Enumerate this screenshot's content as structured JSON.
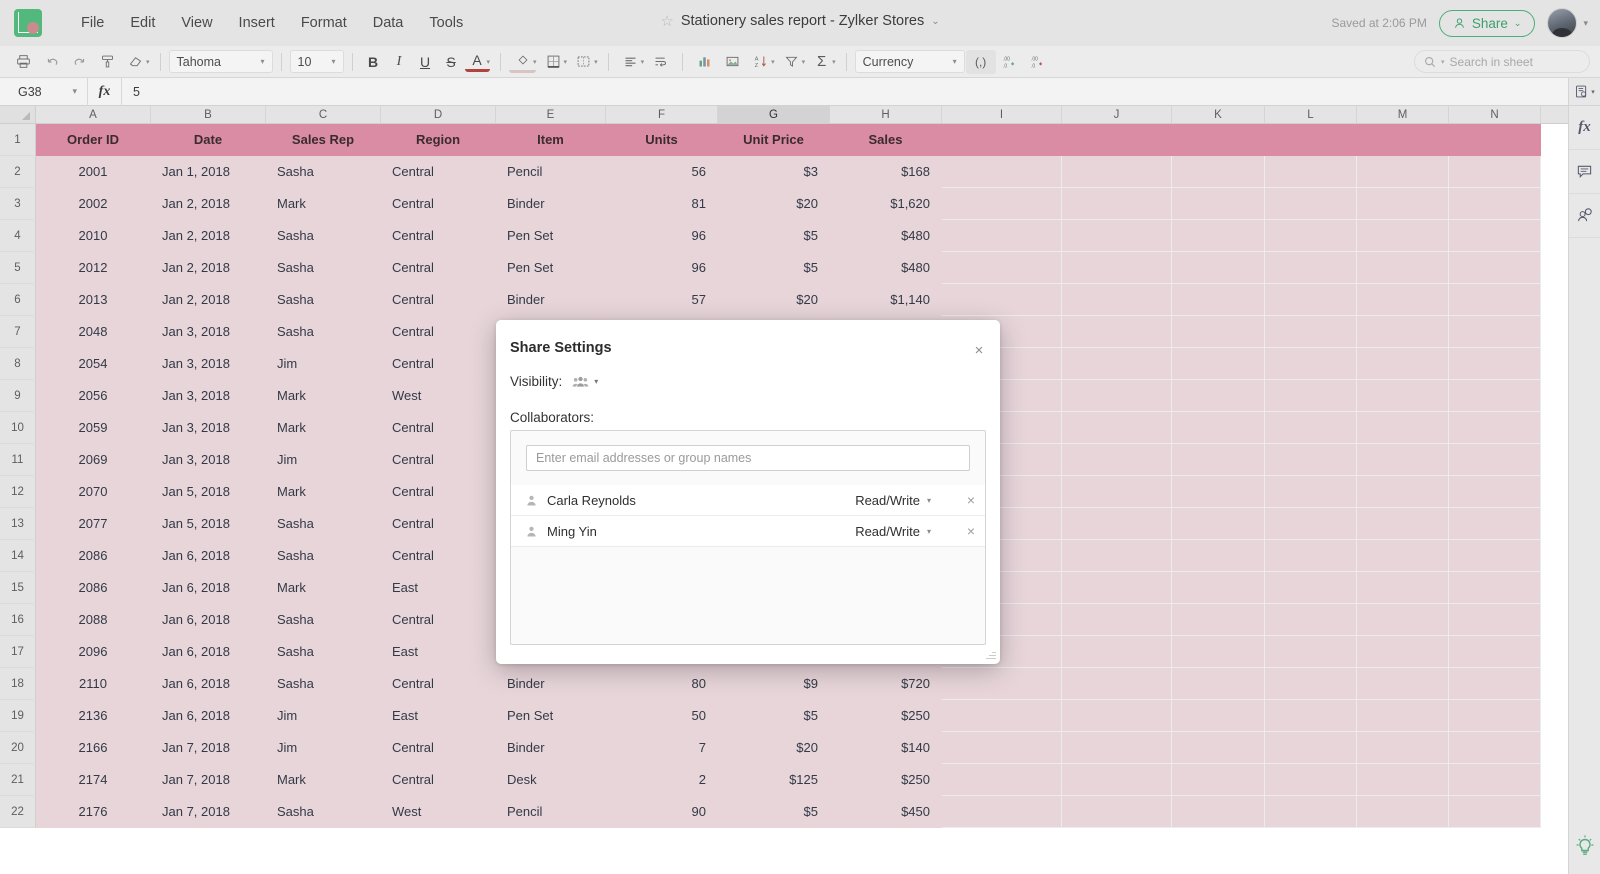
{
  "app": {
    "logo_icon": "sheets-logo-icon",
    "menus": [
      "File",
      "Edit",
      "View",
      "Insert",
      "Format",
      "Data",
      "Tools"
    ],
    "doc_title": "Stationery sales report - Zylker Stores",
    "star_icon": "star-icon",
    "title_caret": "⌄",
    "saved_text": "Saved at 2:06 PM",
    "share_label": "Share",
    "share_caret": "⌄",
    "accent_green": "#4cae7a",
    "header_pink": "#d98ca3",
    "row_pink": "#e7d5da"
  },
  "toolbar": {
    "print_icon": "print-icon",
    "undo_icon": "undo-icon",
    "redo_icon": "redo-icon",
    "paint_format_icon": "paint-format-icon",
    "clear_format_icon": "eraser-icon",
    "font_family": "Tahoma",
    "font_size": "10",
    "bold_label": "B",
    "italic_label": "I",
    "underline_label": "U",
    "strike_label": "S",
    "text_color_label": "A",
    "fill_color_icon": "fill-color-icon",
    "borders_icon": "borders-icon",
    "merge_icon": "merge-cells-icon",
    "align_icon": "align-left-icon",
    "wrap_icon": "wrap-text-icon",
    "chart_icon": "chart-icon",
    "image_icon": "image-icon",
    "sort_icon": "sort-az-icon",
    "filter_icon": "filter-icon",
    "sum_icon": "sum-icon",
    "number_format": "Currency",
    "comma_label": "(,)",
    "decimal_inc_icon": "increase-decimal-icon",
    "decimal_dec_icon": "decrease-decimal-icon",
    "search_placeholder": "Search in sheet",
    "search_icon": "search-icon"
  },
  "formula_bar": {
    "cell_ref": "G38",
    "fx_label": "fx",
    "value": "5",
    "collapse_caret": "⌄",
    "panel_icon": "sheet-panel-icon"
  },
  "rail": {
    "functions_icon": "fx",
    "comment_icon": "comment-icon",
    "collaborate_icon": "collaborator-chat-icon",
    "tips_icon": "lightbulb-tips-icon"
  },
  "sheet": {
    "columns": [
      "A",
      "B",
      "C",
      "D",
      "E",
      "F",
      "G",
      "H",
      "I",
      "J",
      "K",
      "L",
      "M",
      "N"
    ],
    "active_column": "G",
    "headers": [
      "Order ID",
      "Date",
      "Sales Rep",
      "Region",
      "Item",
      "Units",
      "Unit Price",
      "Sales"
    ],
    "rows": [
      {
        "n": "2",
        "cells": [
          "2001",
          "Jan 1, 2018",
          "Sasha",
          "Central",
          "Pencil",
          "56",
          "$3",
          "$168"
        ]
      },
      {
        "n": "3",
        "cells": [
          "2002",
          "Jan 2, 2018",
          "Mark",
          "Central",
          "Binder",
          "81",
          "$20",
          "$1,620"
        ]
      },
      {
        "n": "4",
        "cells": [
          "2010",
          "Jan 2, 2018",
          "Sasha",
          "Central",
          "Pen Set",
          "96",
          "$5",
          "$480"
        ]
      },
      {
        "n": "5",
        "cells": [
          "2012",
          "Jan 2, 2018",
          "Sasha",
          "Central",
          "Pen Set",
          "96",
          "$5",
          "$480"
        ]
      },
      {
        "n": "6",
        "cells": [
          "2013",
          "Jan 2, 2018",
          "Sasha",
          "Central",
          "Binder",
          "57",
          "$20",
          "$1,140"
        ]
      },
      {
        "n": "7",
        "cells": [
          "2048",
          "Jan 3, 2018",
          "Sasha",
          "Central",
          "",
          "",
          "",
          ""
        ]
      },
      {
        "n": "8",
        "cells": [
          "2054",
          "Jan 3, 2018",
          "Jim",
          "Central",
          "",
          "",
          "",
          ""
        ]
      },
      {
        "n": "9",
        "cells": [
          "2056",
          "Jan 3, 2018",
          "Mark",
          "West",
          "",
          "",
          "",
          ""
        ]
      },
      {
        "n": "10",
        "cells": [
          "2059",
          "Jan 3, 2018",
          "Mark",
          "Central",
          "",
          "",
          "",
          ""
        ]
      },
      {
        "n": "11",
        "cells": [
          "2069",
          "Jan 3, 2018",
          "Jim",
          "Central",
          "",
          "",
          "",
          ""
        ]
      },
      {
        "n": "12",
        "cells": [
          "2070",
          "Jan 5, 2018",
          "Mark",
          "Central",
          "",
          "",
          "",
          ""
        ]
      },
      {
        "n": "13",
        "cells": [
          "2077",
          "Jan 5, 2018",
          "Sasha",
          "Central",
          "",
          "",
          "",
          ""
        ]
      },
      {
        "n": "14",
        "cells": [
          "2086",
          "Jan 6, 2018",
          "Sasha",
          "Central",
          "",
          "",
          "",
          ""
        ]
      },
      {
        "n": "15",
        "cells": [
          "2086",
          "Jan 6, 2018",
          "Mark",
          "East",
          "",
          "",
          "",
          ""
        ]
      },
      {
        "n": "16",
        "cells": [
          "2088",
          "Jan 6, 2018",
          "Sasha",
          "Central",
          "",
          "",
          "",
          ""
        ]
      },
      {
        "n": "17",
        "cells": [
          "2096",
          "Jan 6, 2018",
          "Sasha",
          "East",
          "",
          "",
          "",
          ""
        ]
      },
      {
        "n": "18",
        "cells": [
          "2110",
          "Jan 6, 2018",
          "Sasha",
          "Central",
          "Binder",
          "80",
          "$9",
          "$720"
        ]
      },
      {
        "n": "19",
        "cells": [
          "2136",
          "Jan 6, 2018",
          "Jim",
          "East",
          "Pen Set",
          "50",
          "$5",
          "$250"
        ]
      },
      {
        "n": "20",
        "cells": [
          "2166",
          "Jan 7, 2018",
          "Jim",
          "Central",
          "Binder",
          "7",
          "$20",
          "$140"
        ]
      },
      {
        "n": "21",
        "cells": [
          "2174",
          "Jan 7, 2018",
          "Mark",
          "Central",
          "Desk",
          "2",
          "$125",
          "$250"
        ]
      },
      {
        "n": "22",
        "cells": [
          "2176",
          "Jan 7, 2018",
          "Sasha",
          "West",
          "Pencil",
          "90",
          "$5",
          "$450"
        ]
      }
    ]
  },
  "dialog": {
    "title": "Share Settings",
    "close_icon": "close-icon",
    "visibility_label": "Visibility:",
    "visibility_icon": "group-people-icon",
    "visibility_caret": "▾",
    "collaborators_label": "Collaborators:",
    "email_placeholder": "Enter email addresses or group names",
    "collaborators": [
      {
        "name": "Carla Reynolds",
        "permission": "Read/Write"
      },
      {
        "name": "Ming Yin",
        "permission": "Read/Write"
      }
    ],
    "permission_caret": "▾",
    "remove_icon": "×"
  }
}
